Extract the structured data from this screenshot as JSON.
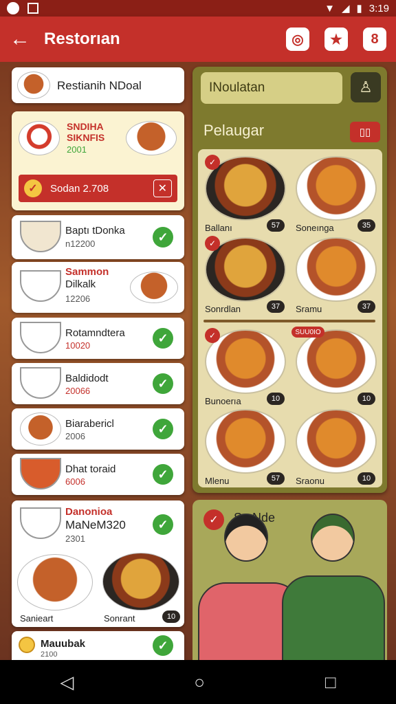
{
  "status_bar": {
    "time": "3:19"
  },
  "app_bar": {
    "title": "Restorıan"
  },
  "restaurant_card": {
    "name": "Restianih NDoal"
  },
  "promo_card": {
    "line1": "SNDIHA",
    "line2": "SIKNFIS",
    "code": "2001",
    "bar_text": "Sodan 2.708"
  },
  "menu_items": [
    {
      "name": "Baptı tDonka",
      "sub": "n12200"
    },
    {
      "name": "Sammon",
      "name2": "Dilkalk",
      "sub": "12206"
    },
    {
      "name": "Rotamndtera",
      "sub": "10020"
    },
    {
      "name": "Baldidodt",
      "sub": "20066"
    },
    {
      "name": "Biarabericl",
      "sub": "2006"
    },
    {
      "name": "Dhat toraid",
      "sub": "6006"
    },
    {
      "name": "Danonioa",
      "name2": "MaNeM320",
      "sub": "2301",
      "dish1": "Sanieart",
      "dish2": "Sonrant",
      "badge": "10"
    },
    {
      "name": "Mauubak",
      "sub": "2100"
    }
  ],
  "right_panel": {
    "search_value": "INoulatan",
    "heading": "Pelaugar",
    "tiles": [
      {
        "label": "Ballanı",
        "badge": "57"
      },
      {
        "label": "Soneınga",
        "badge": "35"
      },
      {
        "label": "Sonrdlan",
        "badge": "37"
      },
      {
        "label": "Sramu",
        "badge": "37"
      },
      {
        "label": "Bunoerıa",
        "badge": "10"
      },
      {
        "label": "",
        "badge": "10"
      },
      {
        "label": "Mlenu",
        "badge": "57"
      },
      {
        "label": "Sraonu",
        "badge": "10"
      }
    ],
    "tag": "SUU0IO"
  },
  "people_card": {
    "title": "Sa Nde"
  },
  "colors": {
    "brand": "#c4302a",
    "panel": "#7e7a2e",
    "check": "#3fa63a"
  }
}
